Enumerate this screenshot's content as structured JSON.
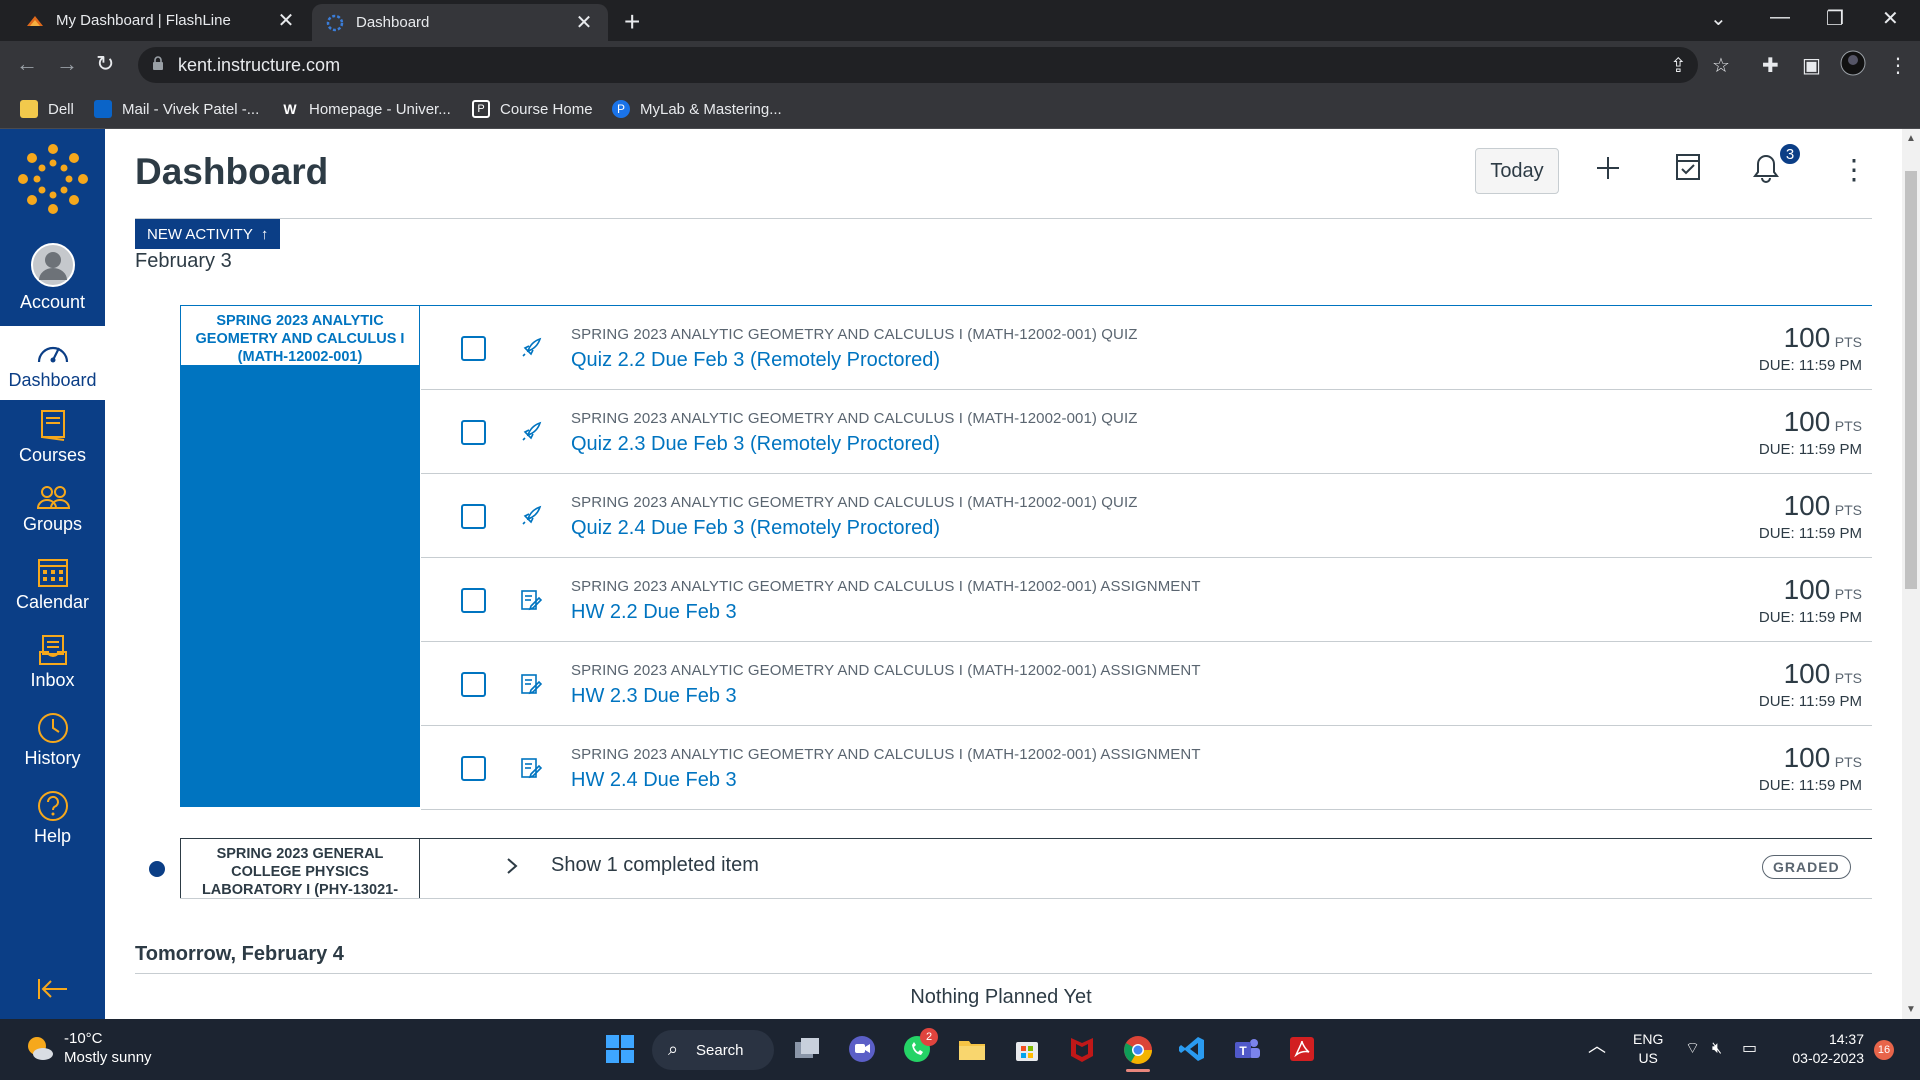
{
  "browser": {
    "tabs": [
      {
        "title": "My Dashboard | FlashLine",
        "active": false
      },
      {
        "title": "Dashboard",
        "active": true
      }
    ],
    "url": "kent.instructure.com",
    "bookmarks": [
      "Dell",
      "Mail - Vivek Patel -...",
      "Homepage - Univer...",
      "Course Home",
      "MyLab & Mastering..."
    ]
  },
  "nav": {
    "items": [
      {
        "label": "Account",
        "icon": "account-avatar-icon"
      },
      {
        "label": "Dashboard",
        "icon": "dashboard-icon",
        "active": true
      },
      {
        "label": "Courses",
        "icon": "courses-icon"
      },
      {
        "label": "Groups",
        "icon": "groups-icon"
      },
      {
        "label": "Calendar",
        "icon": "calendar-icon"
      },
      {
        "label": "Inbox",
        "icon": "inbox-icon"
      },
      {
        "label": "History",
        "icon": "history-icon"
      },
      {
        "label": "Help",
        "icon": "help-icon"
      }
    ]
  },
  "header": {
    "title": "Dashboard",
    "today_label": "Today",
    "notification_count": "3"
  },
  "planner": {
    "new_activity_label": "NEW ACTIVITY",
    "day1": "February 3",
    "course1": "SPRING 2023 ANALYTIC GEOMETRY AND CALCULUS I (MATH-12002-001)",
    "items": [
      {
        "context": "SPRING 2023 ANALYTIC GEOMETRY AND CALCULUS I (MATH-12002-001) QUIZ",
        "title": "Quiz 2.2 Due Feb 3 (Remotely Proctored)",
        "points": "100",
        "unit": "PTS",
        "due": "DUE: 11:59 PM",
        "kind": "quiz-icon"
      },
      {
        "context": "SPRING 2023 ANALYTIC GEOMETRY AND CALCULUS I (MATH-12002-001) QUIZ",
        "title": "Quiz 2.3 Due Feb 3 (Remotely Proctored)",
        "points": "100",
        "unit": "PTS",
        "due": "DUE: 11:59 PM",
        "kind": "quiz-icon"
      },
      {
        "context": "SPRING 2023 ANALYTIC GEOMETRY AND CALCULUS I (MATH-12002-001) QUIZ",
        "title": "Quiz 2.4 Due Feb 3 (Remotely Proctored)",
        "points": "100",
        "unit": "PTS",
        "due": "DUE: 11:59 PM",
        "kind": "quiz-icon"
      },
      {
        "context": "SPRING 2023 ANALYTIC GEOMETRY AND CALCULUS I (MATH-12002-001) ASSIGNMENT",
        "title": "HW 2.2 Due Feb 3",
        "points": "100",
        "unit": "PTS",
        "due": "DUE: 11:59 PM",
        "kind": "assignment-icon"
      },
      {
        "context": "SPRING 2023 ANALYTIC GEOMETRY AND CALCULUS I (MATH-12002-001) ASSIGNMENT",
        "title": "HW 2.3 Due Feb 3",
        "points": "100",
        "unit": "PTS",
        "due": "DUE: 11:59 PM",
        "kind": "assignment-icon"
      },
      {
        "context": "SPRING 2023 ANALYTIC GEOMETRY AND CALCULUS I (MATH-12002-001) ASSIGNMENT",
        "title": "HW 2.4 Due Feb 3",
        "points": "100",
        "unit": "PTS",
        "due": "DUE: 11:59 PM",
        "kind": "assignment-icon"
      }
    ],
    "course2": "SPRING 2023 GENERAL COLLEGE PHYSICS LABORATORY I (PHY-13021-",
    "show_completed": "Show 1 completed item",
    "graded_badge": "GRADED",
    "day2": "Tomorrow, February 4",
    "nothing_planned": "Nothing Planned Yet"
  },
  "taskbar": {
    "weather_temp": "-10°C",
    "weather_desc": "Mostly sunny",
    "search_label": "Search",
    "whatsapp_badge": "2",
    "lang_line1": "ENG",
    "lang_line2": "US",
    "time": "14:37",
    "date": "03-02-2023",
    "notif_count": "16"
  },
  "colors": {
    "nav_bg": "#0b3e86",
    "course_color": "#0074c0",
    "text": "#2d3b45"
  }
}
